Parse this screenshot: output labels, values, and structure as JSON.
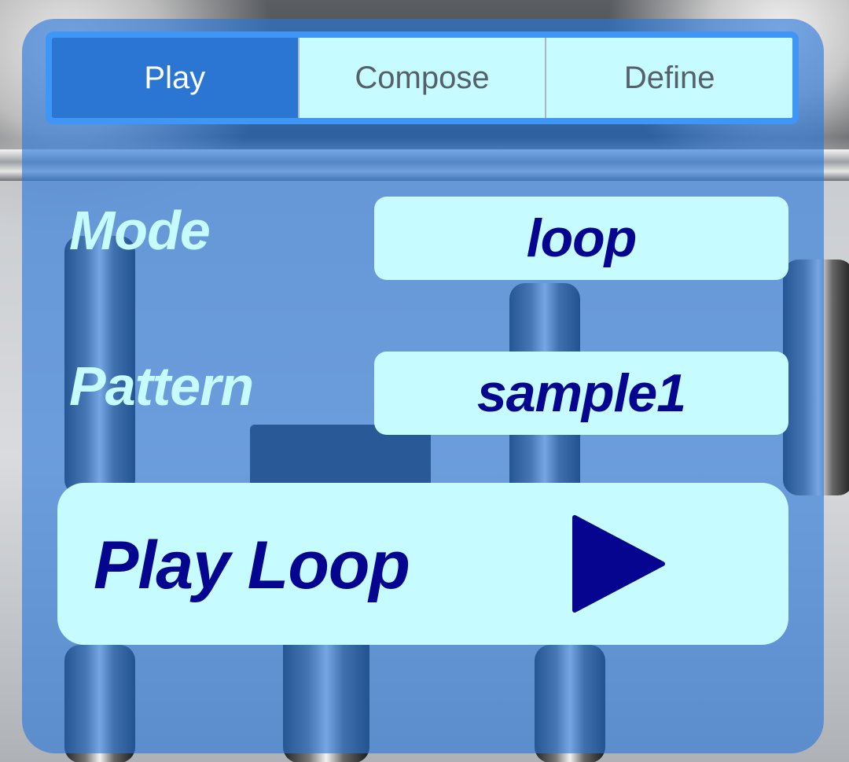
{
  "tabs": [
    {
      "label": "Play",
      "active": true
    },
    {
      "label": "Compose",
      "active": false
    },
    {
      "label": "Define",
      "active": false
    }
  ],
  "mode": {
    "label": "Mode",
    "value": "loop"
  },
  "pattern": {
    "label": "Pattern",
    "value": "sample1"
  },
  "play_button": {
    "label": "Play Loop",
    "icon": "play-icon"
  },
  "colors": {
    "panel": "#2876da",
    "tab_active": "#2a76d2",
    "field_bg": "#c6fbff",
    "value_text": "#05058f",
    "label_text": "#c6fbff"
  }
}
